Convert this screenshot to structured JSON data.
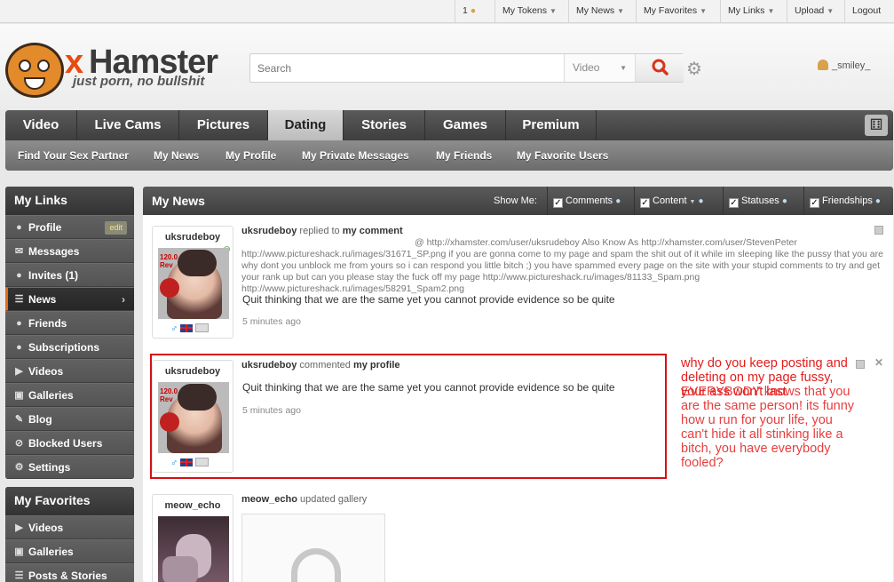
{
  "topbar": {
    "count": "1",
    "items": [
      "My Tokens",
      "My News",
      "My Favorites",
      "My Links",
      "Upload"
    ],
    "logout": "Logout"
  },
  "header": {
    "logo_x": "x",
    "logo_name": "Hamster",
    "logo_slogan": "just porn, no bullshit",
    "search_placeholder": "Search",
    "search_type": "Video",
    "username": "_smiley_"
  },
  "nav": {
    "tabs": [
      "Video",
      "Live Cams",
      "Pictures",
      "Dating",
      "Stories",
      "Games",
      "Premium"
    ],
    "active_tab": "Dating",
    "sub": [
      "Find Your Sex Partner",
      "My News",
      "My Profile",
      "My Private Messages",
      "My Friends",
      "My Favorite Users"
    ]
  },
  "sidebar": {
    "links_title": "My Links",
    "links": [
      {
        "label": "Profile",
        "icon": "user-icon",
        "badge": "edit"
      },
      {
        "label": "Messages",
        "icon": "envelope-icon"
      },
      {
        "label": "Invites (1)",
        "icon": "user-add-icon"
      },
      {
        "label": "News",
        "icon": "news-icon",
        "active": true
      },
      {
        "label": "Friends",
        "icon": "friends-icon"
      },
      {
        "label": "Subscriptions",
        "icon": "subscriptions-icon"
      },
      {
        "label": "Videos",
        "icon": "video-icon"
      },
      {
        "label": "Galleries",
        "icon": "camera-icon"
      },
      {
        "label": "Blog",
        "icon": "blog-icon"
      },
      {
        "label": "Blocked Users",
        "icon": "block-icon"
      },
      {
        "label": "Settings",
        "icon": "gear-icon"
      }
    ],
    "favorites_title": "My Favorites",
    "favorites": [
      {
        "label": "Videos",
        "icon": "video-icon"
      },
      {
        "label": "Galleries",
        "icon": "camera-icon"
      },
      {
        "label": "Posts & Stories",
        "icon": "posts-icon"
      }
    ]
  },
  "main": {
    "title": "My News",
    "show_me": "Show Me:",
    "filters": [
      "Comments",
      "Content",
      "Statuses",
      "Friendships"
    ],
    "feed": [
      {
        "user": "uksrudeboy",
        "action": "replied to",
        "target": "my comment",
        "body": "@ http://xhamster.com/user/uksrudeboy Also Know As http://xhamster.com/user/StevenPeter http://www.pictureshack.ru/images/31671_SP.png if you are gonna come to my page and spam the shit out of it while im sleeping like the pussy that you are why dont you unblock me from yours so i can respond you little bitch ;) you have spammed every page on the site with your stupid comments to try and get your rank up but can you please stay the fuck off my page http://www.pictureshack.ru/images/81133_Spam.png http://www.pictureshack.ru/images/58291_Spam2.png",
        "quote": "Quit thinking that we are the same yet you cannot provide evidence so be quite",
        "time": "5 minutes ago"
      },
      {
        "user": "uksrudeboy",
        "action": "commented",
        "target": "my profile",
        "quote": "Quit thinking that we are the same yet you cannot provide evidence so be quite",
        "time": "5 minutes ago"
      },
      {
        "user": "meow_echo",
        "action": "updated gallery"
      }
    ],
    "annotation_a": "why do you keep posting and deleting on my page fussy, your ass won't last",
    "annotation_b": "EVERYBODY knows that you are the same person! its funny how u run for your life, you can't hide it all stinking like a bitch, you have everybody fooled?"
  }
}
